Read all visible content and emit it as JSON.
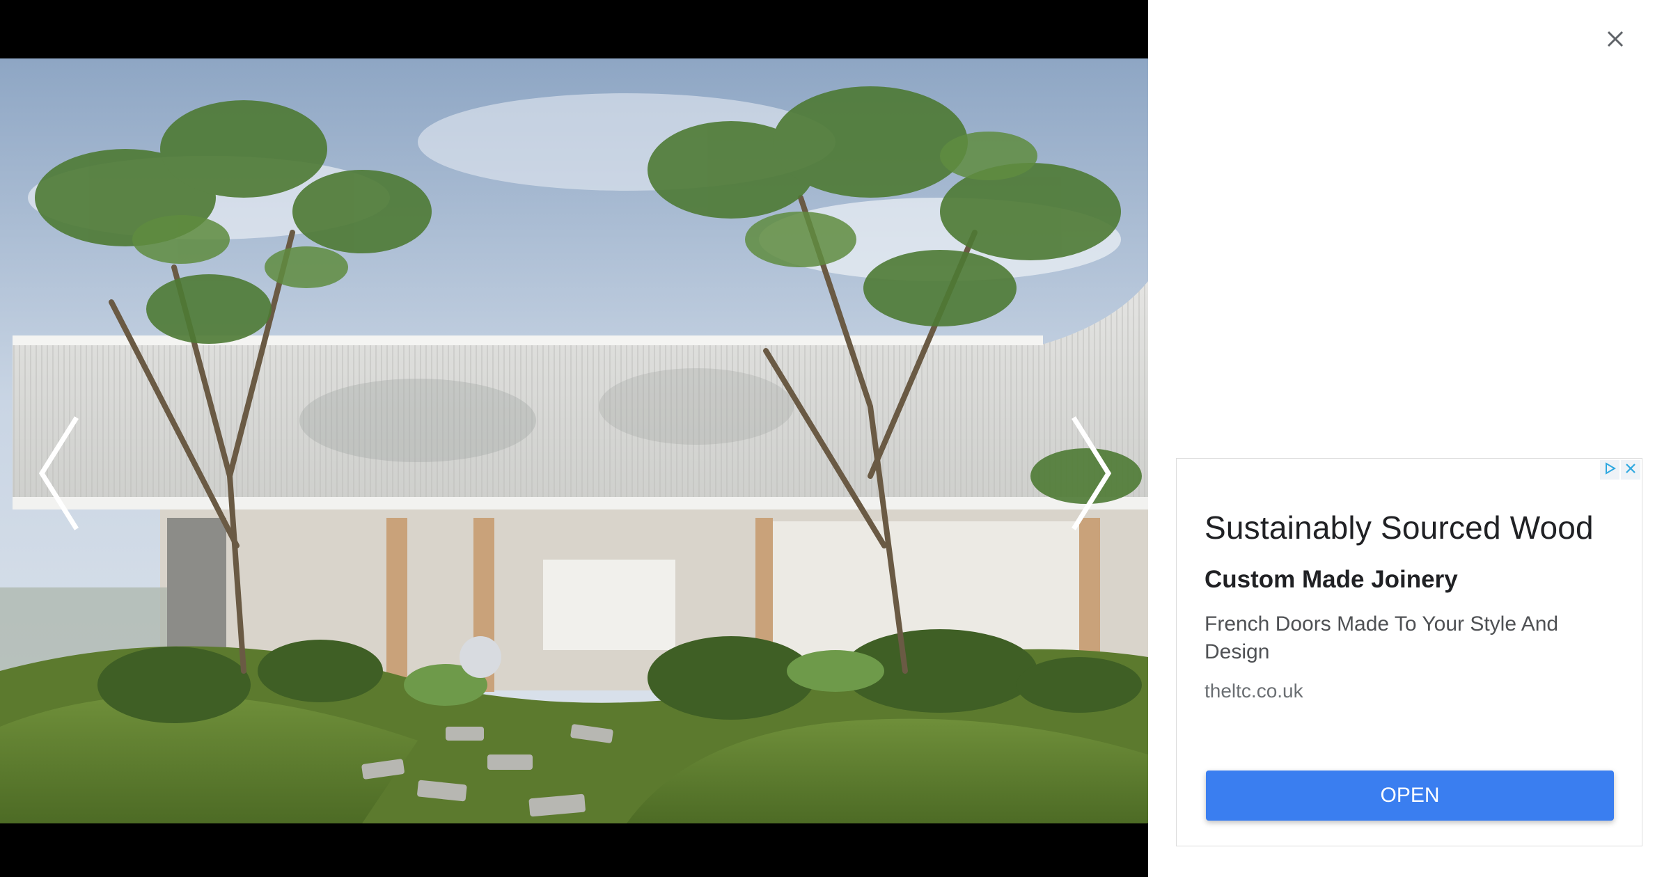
{
  "viewer": {
    "image_alt": "Modern white house with garden and trees",
    "prev_icon": "chevron-left-icon",
    "next_icon": "chevron-right-icon"
  },
  "panel": {
    "close_icon": "close-icon"
  },
  "ad": {
    "headline": "Sustainably Sourced Wood",
    "subheadline": "Custom Made Joinery",
    "description": "French Doors Made To Your Style And Design",
    "domain": "theltc.co.uk",
    "cta_label": "OPEN",
    "adchoices_icon": "adchoices-icon",
    "ad_close_icon": "ad-close-icon",
    "accent_color": "#3a7ef0"
  }
}
